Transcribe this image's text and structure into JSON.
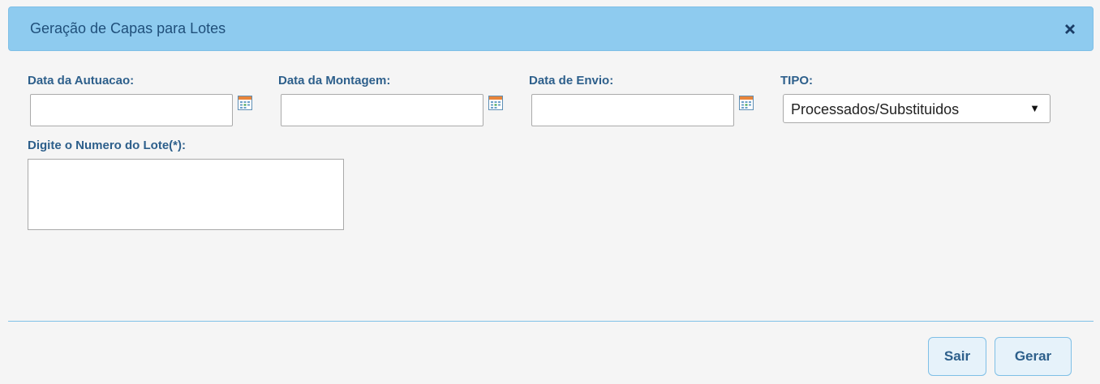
{
  "dialog": {
    "title": "Geração de Capas para Lotes",
    "close_icon": "close-x-icon"
  },
  "fields": {
    "data_autuacao": {
      "label": "Data da Autuacao:",
      "value": ""
    },
    "data_montagem": {
      "label": "Data da Montagem:",
      "value": ""
    },
    "data_envio": {
      "label": "Data de Envio:",
      "value": ""
    },
    "tipo": {
      "label": "TIPO:",
      "selected": "Processados/Substituidos"
    },
    "numero_lote": {
      "label": "Digite o Numero do Lote(*):",
      "value": ""
    }
  },
  "buttons": {
    "sair": "Sair",
    "gerar": "Gerar"
  },
  "icons": {
    "calendar": "calendar-icon",
    "dropdown": "triangle-down-icon"
  },
  "colors": {
    "title_bar": "#8ecbef",
    "label_text": "#2d5f8b",
    "button_bg": "#e6f2fa"
  }
}
